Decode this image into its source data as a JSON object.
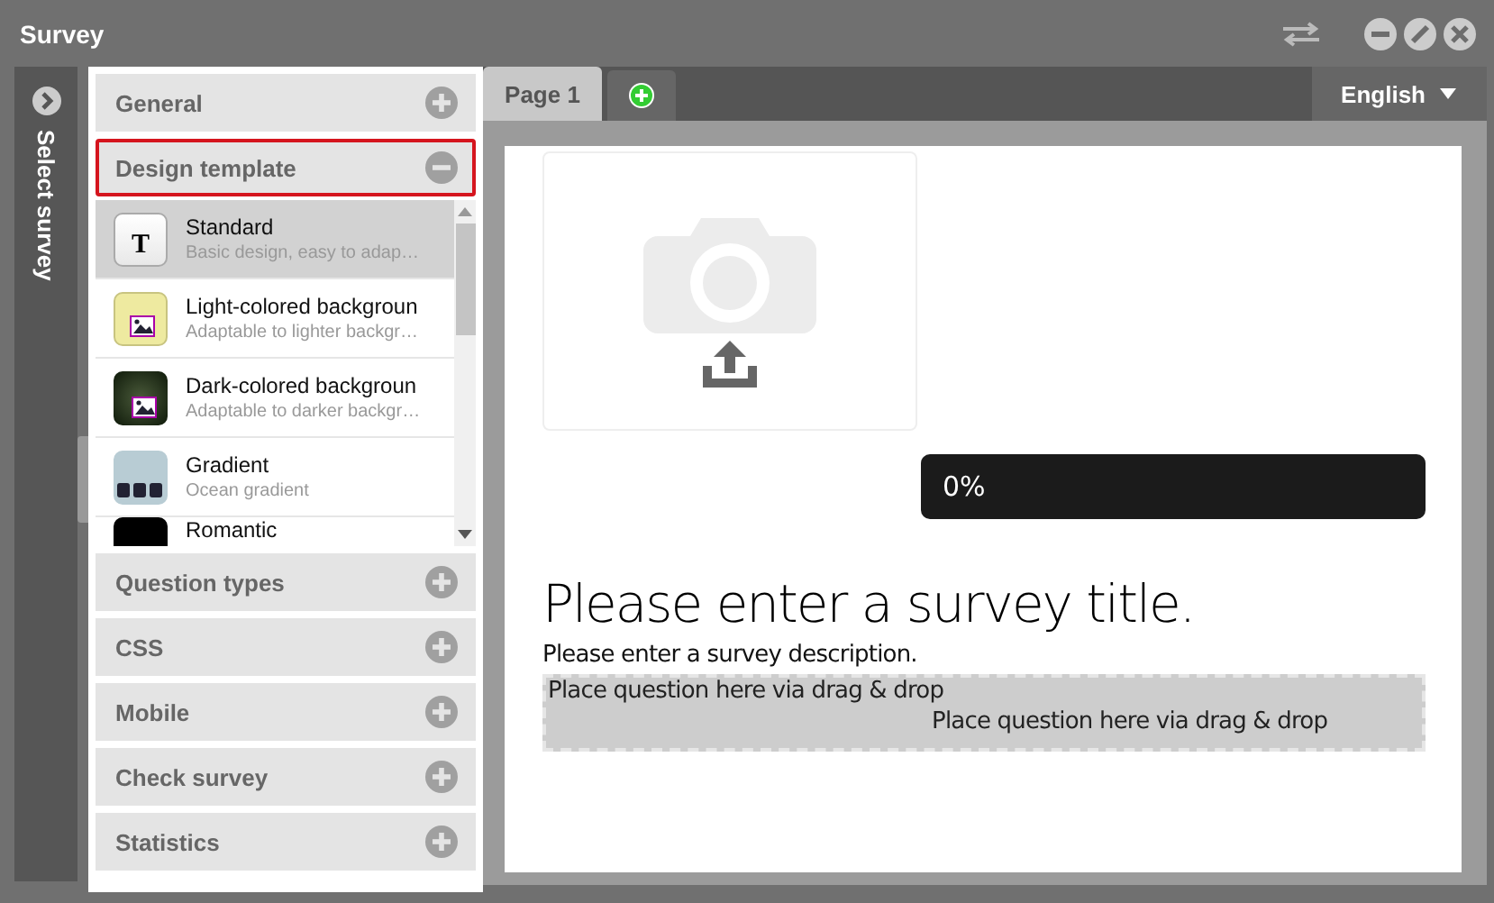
{
  "window": {
    "title": "Survey"
  },
  "side_strip": {
    "label": "Select survey"
  },
  "sections": [
    {
      "label": "General",
      "expanded": false,
      "highlighted": false
    },
    {
      "label": "Design template",
      "expanded": true,
      "highlighted": true,
      "templates": [
        {
          "title": "Standard",
          "subtitle": "Basic design, easy to adap…",
          "kind": "text",
          "thumb_text": "T",
          "selected": true
        },
        {
          "title": "Light-colored backgroun",
          "subtitle": "Adaptable to lighter backgr…",
          "kind": "light",
          "selected": false
        },
        {
          "title": "Dark-colored backgroun",
          "subtitle": "Adaptable to darker backgr…",
          "kind": "dark",
          "selected": false
        },
        {
          "title": "Gradient",
          "subtitle": "Ocean gradient",
          "kind": "gradient",
          "selected": false
        },
        {
          "title": "Romantic",
          "kind": "black",
          "selected": false
        }
      ]
    },
    {
      "label": "Question types",
      "expanded": false,
      "highlighted": false
    },
    {
      "label": "CSS",
      "expanded": false,
      "highlighted": false
    },
    {
      "label": "Mobile",
      "expanded": false,
      "highlighted": false
    },
    {
      "label": "Check survey",
      "expanded": false,
      "highlighted": false
    },
    {
      "label": "Statistics",
      "expanded": false,
      "highlighted": false
    }
  ],
  "tabs": [
    {
      "kind": "page",
      "label": "Page 1",
      "selected": true
    },
    {
      "kind": "add",
      "selected": false
    }
  ],
  "language": {
    "value": "English"
  },
  "page": {
    "progress": {
      "text": "0%",
      "level": 0
    },
    "title": "Please enter a survey title.",
    "description": "Please enter a survey description.",
    "drop_zone": {
      "texts": [
        "Place question here via drag & drop",
        "Place question here via drag & drop"
      ]
    }
  }
}
